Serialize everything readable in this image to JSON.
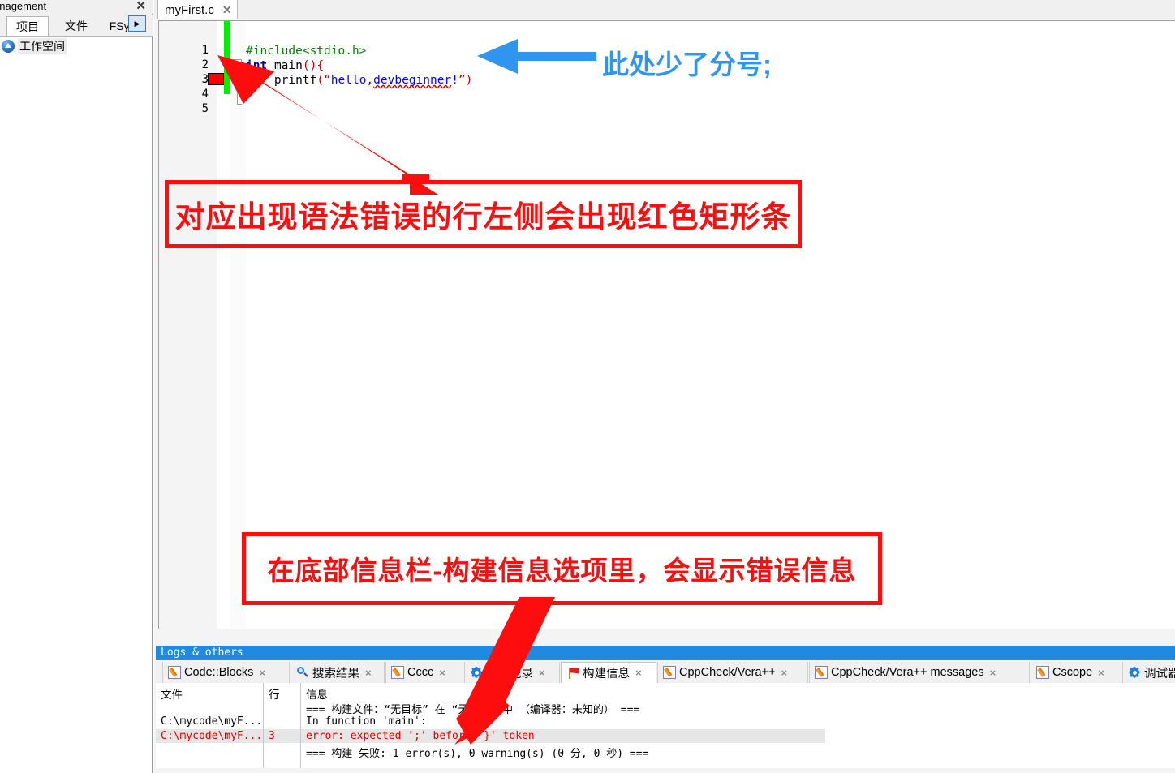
{
  "left_panel": {
    "title": "anagement",
    "close_icon": "close-icon",
    "tabs": [
      {
        "label": "项目",
        "active": true
      },
      {
        "label": "文件",
        "active": false
      },
      {
        "label": "FSym",
        "active": false
      }
    ],
    "more_arrow": "▶",
    "tree": {
      "root_label": "工作空间",
      "root_icon": "workspace-icon"
    }
  },
  "editor": {
    "tab": {
      "label": "myFirst.c",
      "close_icon": "close-icon"
    },
    "line_numbers": [
      "1",
      "2",
      "3",
      "4",
      "5"
    ],
    "error_line": 3,
    "code": {
      "line1": {
        "preproc": "#include<stdio.h>"
      },
      "line2": {
        "keyword": "int",
        "space": " ",
        "name": "main",
        "parens": "()",
        "brace": "{"
      },
      "line3": {
        "indent": "    ",
        "name": "printf",
        "open": "(",
        "quote_open": "“",
        "string": "hello,",
        "squiggle": "devbeginner",
        "bang": "!",
        "quote_close": "”",
        "close": ")"
      },
      "line4": "",
      "line5": ""
    },
    "scrollbar": "horizontal-scrollbar"
  },
  "logs": {
    "header": "Logs & others",
    "tabs": [
      {
        "label": "Code::Blocks",
        "icon": "pencil-icon",
        "active": false
      },
      {
        "label": "搜索结果",
        "icon": "search-icon",
        "active": false
      },
      {
        "label": "Cccc",
        "icon": "pencil-icon",
        "active": false
      },
      {
        "label": "构建记录",
        "icon": "gear-icon",
        "active": false
      },
      {
        "label": "构建信息",
        "icon": "flag-icon",
        "active": true
      },
      {
        "label": "CppCheck/Vera++",
        "icon": "pencil-icon",
        "active": false
      },
      {
        "label": "CppCheck/Vera++ messages",
        "icon": "pencil-icon",
        "active": false
      },
      {
        "label": "Cscope",
        "icon": "pencil-icon",
        "active": false
      },
      {
        "label": "调试器",
        "icon": "gear-icon",
        "active": false
      }
    ],
    "close_icon": "×",
    "table": {
      "headers": {
        "file": "文件",
        "line": "行",
        "message": "信息"
      },
      "rows": [
        {
          "file": "",
          "line": "",
          "message": "=== 构建文件：“无目标” 在 “无项目” 中 （编译器：未知的） ===",
          "error": false
        },
        {
          "file": "C:\\mycode\\myF...",
          "line": "",
          "message": "In function 'main':",
          "error": false
        },
        {
          "file": "C:\\mycode\\myF...",
          "line": "3",
          "message": "error: expected ';' before '}' token",
          "error": true
        },
        {
          "file": "",
          "line": "",
          "message": "=== 构建 失败: 1 error(s), 0 warning(s) (0 分, 0 秒) ===",
          "error": false
        }
      ]
    }
  },
  "annotations": {
    "blue_note": "此处少了分号;",
    "note1": "对应出现语法错误的行左侧会出现红色矩形条",
    "note2": "在底部信息栏-构建信息选项里，会显示错误信息"
  },
  "colors": {
    "annotation_red": "#fd0d0d",
    "annotation_blue": "#2f95ef",
    "error_text": "#e00000",
    "change_bar_green": "#00ee00",
    "logs_header_blue": "#1f8ae0"
  }
}
